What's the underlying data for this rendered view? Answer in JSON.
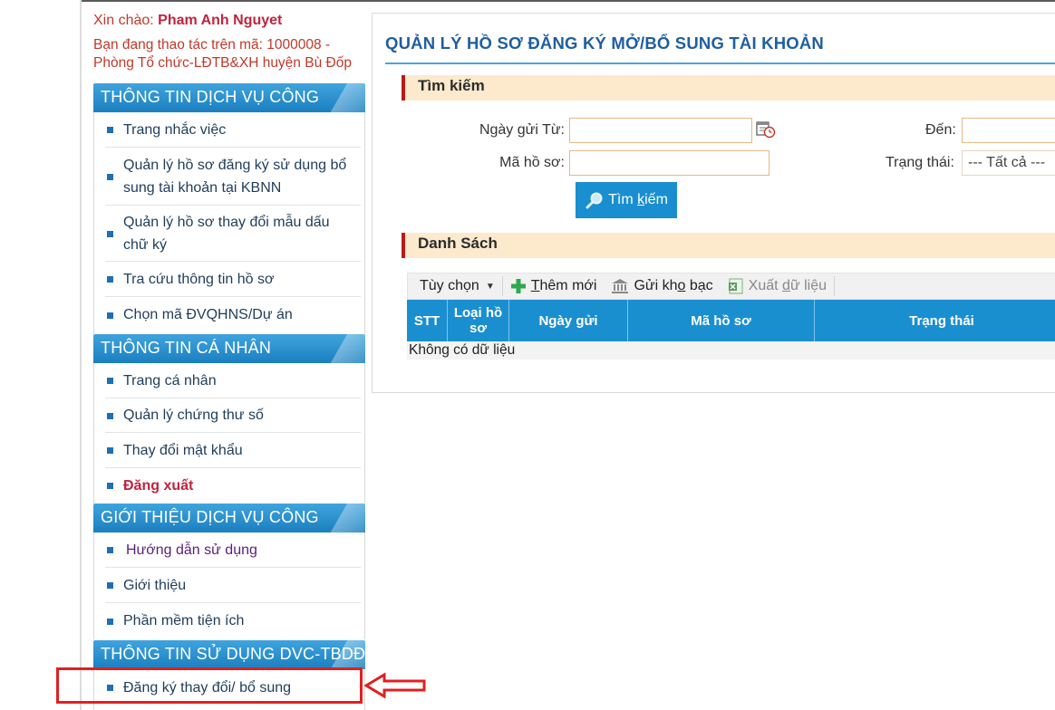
{
  "user": {
    "greeting_prefix": "Xin chào:",
    "name": "Pham Anh Nguyet"
  },
  "context_text": "Bạn đang thao tác trên mã: 1000008 - Phòng Tổ chức-LĐTB&XH huyện Bù Đốp",
  "sidebar": {
    "sections": [
      {
        "title": "THÔNG TIN DỊCH VỤ CÔNG",
        "items": [
          "Trang nhắc việc",
          "Quản lý hồ sơ đăng ký sử dụng bổ sung tài khoản tại KBNN",
          "Quản lý hồ sơ thay đổi mẫu dấu chữ ký",
          "Tra cứu thông tin hồ sơ",
          "Chọn mã ĐVQHNS/Dự án"
        ]
      },
      {
        "title": "THÔNG TIN CÁ NHÂN",
        "items": [
          "Trang cá nhân",
          "Quản lý chứng thư số",
          "Thay đổi mật khẩu",
          "Đăng xuất"
        ]
      },
      {
        "title": "GIỚI THIỆU DỊCH VỤ CÔNG",
        "items": [
          "Hướng dẫn sử dụng",
          "Giới thiệu",
          "Phần mềm tiện ích"
        ]
      },
      {
        "title": "THÔNG TIN SỬ DỤNG DVC-TBDĐ",
        "items": [
          "Đăng ký thay đổi/ bổ sung"
        ]
      }
    ]
  },
  "main": {
    "title": "QUẢN LÝ HỒ SƠ ĐĂNG KÝ MỞ/BỔ SUNG TÀI KHOẢN",
    "search_panel": {
      "header": "Tìm kiếm",
      "date_from_label": "Ngày gửi Từ:",
      "date_to_label": "Đến:",
      "code_label": "Mã hồ sơ:",
      "status_label": "Trạng thái:",
      "status_value": "--- Tất cả ---",
      "date_from_value": "",
      "date_to_value": "",
      "code_value": "",
      "search_button": {
        "before": "Tìm ",
        "underlined": "k",
        "after": "iếm"
      }
    },
    "list_panel": {
      "header": "Danh Sách",
      "toolbar": {
        "options": "Tùy chọn",
        "add": {
          "underlined": "T",
          "after": "hêm mới"
        },
        "send": {
          "before": "Gửi kh",
          "underlined": "o",
          "after": " bạc"
        },
        "export": {
          "before": "Xuất ",
          "underlined": "d",
          "after": "ữ liệu"
        }
      },
      "columns": [
        "STT",
        "Loại hồ sơ",
        "Ngày gửi",
        "Mã hồ sơ",
        "Trạng thái"
      ],
      "empty_text": "Không có dữ liệu"
    }
  },
  "colors": {
    "accent": "#1a8fd0",
    "highlight": "#e02020",
    "panel_bg": "#fde9cc",
    "title": "#1f5f9e"
  }
}
